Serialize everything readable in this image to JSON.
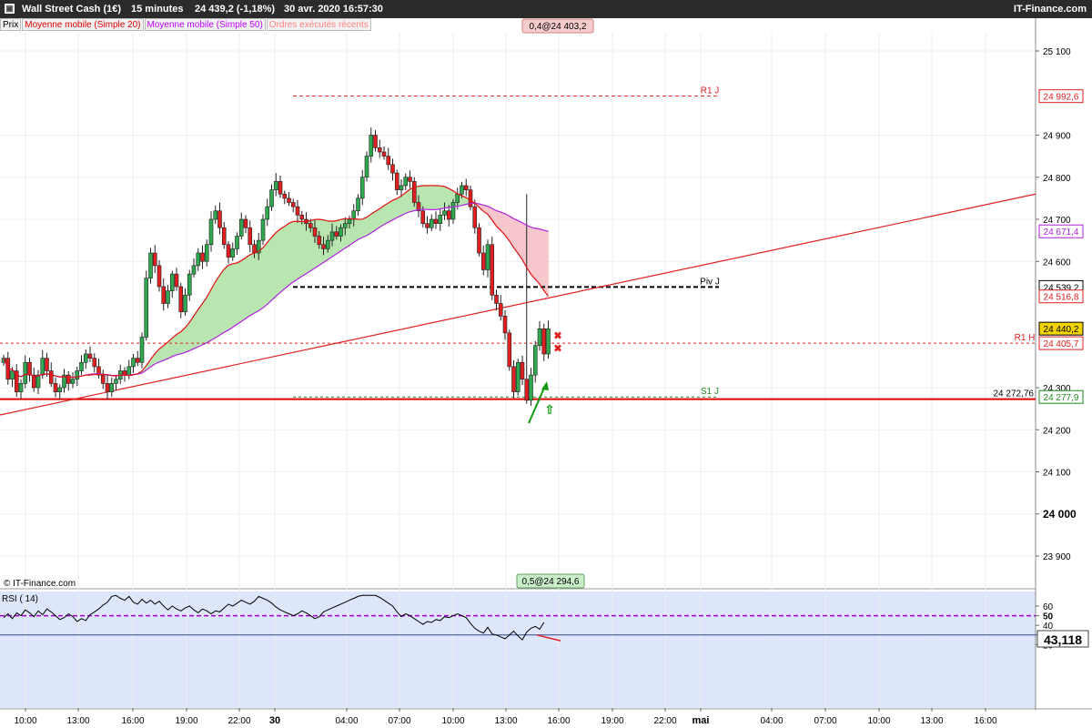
{
  "header": {
    "title": "Wall Street Cash (1€)",
    "timeframe": "15 minutes",
    "quote": "24 439,2 (-1,18%)",
    "datetime": "30 avr. 2020 16:57:30",
    "brand": "IT-Finance.com"
  },
  "legend": {
    "price": "Prix",
    "ma20": "Moyenne mobile (Simple 20)",
    "ma50": "Moyenne mobile (Simple 50)",
    "orders": "Ordres exécutés récents"
  },
  "colors": {
    "up": "#2fa84f",
    "down": "#e02020",
    "ma20": "#e01010",
    "ma50": "#b020e0",
    "cloud_green": "#b9e6b0",
    "cloud_red": "#f7c6cc",
    "rsi_bg": "#dde6fb",
    "accent_arrow": "#119911"
  },
  "watermark": "© IT-Finance.com",
  "chart_data": [
    {
      "type": "candlestick",
      "ylim": [
        23800,
        25150
      ],
      "yticks": [
        "25 100",
        "24 900",
        "24 800",
        "24 700",
        "24 600",
        "24 300",
        "24 200",
        "24 100",
        "24 000",
        "23 900"
      ],
      "ytick_values": [
        25100,
        24900,
        24800,
        24700,
        24600,
        24300,
        24200,
        24100,
        24000,
        23900
      ],
      "xticks": [
        "10:00",
        "13:00",
        "16:00",
        "19:00",
        "22:00",
        "30",
        "04:00",
        "07:00",
        "10:00",
        "13:00",
        "16:00",
        "19:00",
        "22:00",
        "mai",
        "04:00",
        "07:00",
        "10:00",
        "13:00",
        "16:00"
      ],
      "close": [
        24370,
        24320,
        24340,
        24290,
        24310,
        24360,
        24330,
        24300,
        24330,
        24370,
        24340,
        24310,
        24290,
        24300,
        24330,
        24310,
        24320,
        24340,
        24360,
        24380,
        24370,
        24350,
        24330,
        24310,
        24290,
        24310,
        24320,
        24340,
        24330,
        24350,
        24370,
        24360,
        24420,
        24560,
        24620,
        24590,
        24540,
        24500,
        24530,
        24570,
        24540,
        24480,
        24520,
        24570,
        24590,
        24620,
        24600,
        24640,
        24700,
        24720,
        24680,
        24640,
        24610,
        24630,
        24660,
        24700,
        24680,
        24640,
        24620,
        24650,
        24700,
        24730,
        24770,
        24790,
        24760,
        24750,
        24740,
        24730,
        24710,
        24700,
        24690,
        24680,
        24660,
        24640,
        24630,
        24650,
        24670,
        24660,
        24680,
        24690,
        24700,
        24720,
        24750,
        24800,
        24850,
        24900,
        24870,
        24860,
        24850,
        24830,
        24810,
        24770,
        24780,
        24800,
        24790,
        24740,
        24720,
        24690,
        24680,
        24700,
        24690,
        24710,
        24720,
        24700,
        24740,
        24760,
        24780,
        24770,
        24730,
        24680,
        24620,
        24580,
        24640,
        24520,
        24500,
        24470,
        24430,
        24350,
        24290,
        24360,
        24320,
        24270,
        24330,
        24400,
        24440,
        24380,
        24440
      ],
      "ma20_final": 24516.8,
      "ma50_final": 24671.4,
      "resistance_trendline": {
        "from": 24300,
        "to": 24760
      },
      "levels": [
        {
          "name": "R1 J",
          "value": 24992.6
        },
        {
          "name": "Piv J",
          "value": 24539.2
        },
        {
          "name": "R1 H",
          "value": 24405.7
        },
        {
          "name": "S1 J",
          "value": 24277.9
        },
        {
          "name": "",
          "value": 24272.76
        }
      ],
      "price_tags": [
        "24 992,6",
        "24 671,4",
        "24 539,2",
        "24 516,8",
        "24 440,2",
        "24 405,7",
        "24 277,9"
      ],
      "level_labels": [
        "R1 J",
        "Piv J",
        "R1 H",
        "S1 J"
      ],
      "support_value_label": "24 272,76",
      "orders": [
        {
          "label": "0,4@24 403,2",
          "value": 24403.2
        },
        {
          "label": "0,5@24 294,6",
          "value": 24294.6
        }
      ]
    },
    {
      "type": "line",
      "name": "RSI ( 14)",
      "ylim": [
        10,
        67
      ],
      "yticks": [
        "60",
        "50",
        "40",
        "30",
        "20"
      ],
      "ytick_values": [
        60,
        50,
        40,
        30,
        20
      ],
      "levels": [
        50,
        30
      ],
      "last_value": "43,118",
      "values": [
        48,
        52,
        47,
        53,
        50,
        56,
        53,
        49,
        55,
        51,
        57,
        54,
        50,
        46,
        48,
        52,
        49,
        44,
        47,
        45,
        51,
        54,
        57,
        61,
        64,
        70,
        72,
        68,
        66,
        70,
        64,
        62,
        67,
        63,
        66,
        62,
        65,
        60,
        56,
        60,
        57,
        55,
        58,
        60,
        56,
        53,
        57,
        55,
        52,
        55,
        54,
        58,
        62,
        60,
        63,
        66,
        64,
        62,
        65,
        70,
        68,
        66,
        63,
        59,
        56,
        54,
        52,
        50,
        52,
        55,
        53,
        50,
        47,
        49,
        54,
        56,
        58,
        60,
        62,
        64,
        66,
        68,
        70,
        72,
        74,
        73,
        71,
        69,
        66,
        63,
        60,
        54,
        49,
        52,
        50,
        47,
        44,
        41,
        44,
        43,
        46,
        45,
        49,
        48,
        50,
        52,
        50,
        48,
        42,
        37,
        34,
        32,
        38,
        31,
        30,
        28,
        26,
        30,
        34,
        29,
        25,
        33,
        37,
        39,
        36,
        43
      ]
    }
  ]
}
